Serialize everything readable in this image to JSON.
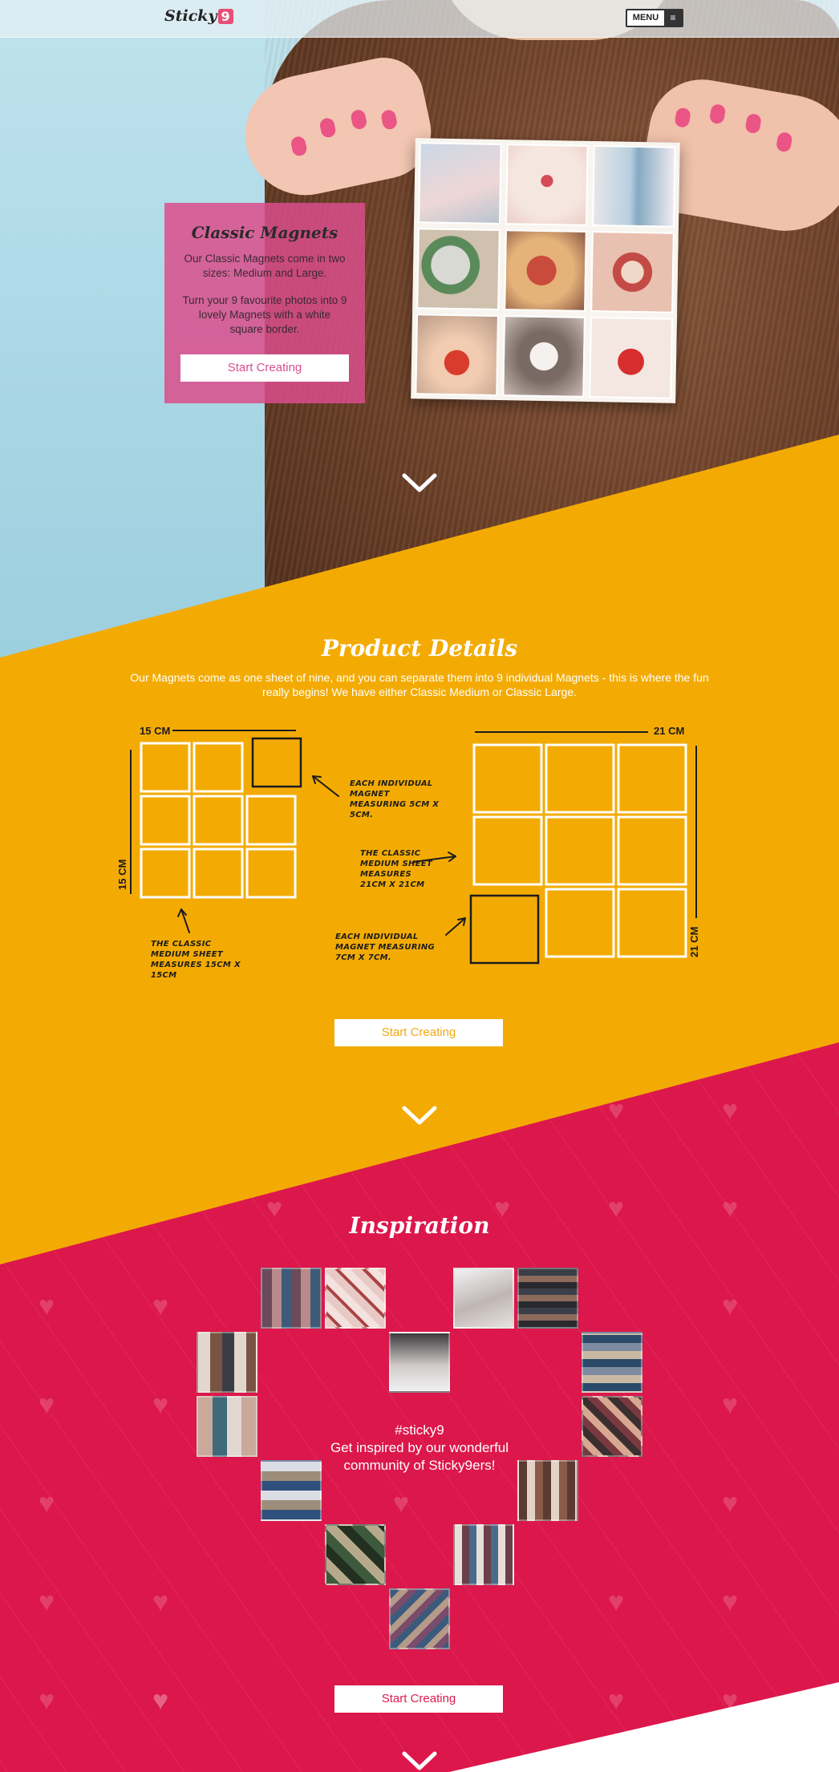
{
  "nav": {
    "logo_text": "Sticky",
    "logo_badge": "9",
    "menu_label": "MENU"
  },
  "hero": {
    "card_title": "Classic Magnets",
    "card_p1": "Our Classic Magnets come in two sizes: Medium and Large.",
    "card_p2": "Turn your 9 favourite photos into 9 lovely Magnets with a white square border.",
    "cta": "Start Creating"
  },
  "details": {
    "title": "Product Details",
    "text": "Our Magnets come as one sheet of nine, and you can separate them into 9 individual Magnets - this is where the fun really begins! We have either Classic Medium or Classic Large.",
    "medium_width_label": "15 CM",
    "medium_height_label": "15 CM",
    "large_width_label": "21 CM",
    "large_height_label": "21 CM",
    "note_medium_magnet": "Each individual Magnet measuring 5cm x 5cm.",
    "note_medium_sheet": "The Classic Medium sheet measures 15cm x 15cm",
    "note_large_sheet": "The Classic Medium sheet measures 21cm x 21cm",
    "note_large_magnet": "Each individual Magnet measuring 7cm x 7cm.",
    "cta": "Start Creating"
  },
  "inspiration": {
    "title": "Inspiration",
    "hashtag": "#sticky9",
    "line1": "Get inspired by our wonderful",
    "line2": "community of Sticky9ers!",
    "cta": "Start Creating"
  },
  "colors": {
    "pink": "#e94e77",
    "yellow": "#f3ab04",
    "red": "#dc174b",
    "sky": "#a9d6e4"
  }
}
